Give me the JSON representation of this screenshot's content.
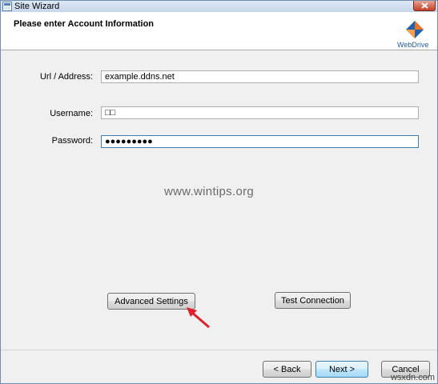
{
  "window": {
    "title": "Site Wizard",
    "header_title": "Please enter Account Information",
    "logo_text": "WebDrive"
  },
  "form": {
    "url_label": "Url / Address:",
    "url_value": "example.ddns.net",
    "username_label": "Username:",
    "username_value": "□□",
    "password_label": "Password:",
    "password_value": "●●●●●●●●●"
  },
  "watermark": "www.wintips.org",
  "buttons": {
    "advanced_settings": "Advanced Settings",
    "test_connection": "Test Connection",
    "back": "< Back",
    "next": "Next >",
    "cancel": "Cancel"
  },
  "site_mark": "wsxdn.com",
  "colors": {
    "accent_arrow": "#e0202a",
    "logo_blue": "#2360a8",
    "logo_orange": "#e8742a"
  }
}
